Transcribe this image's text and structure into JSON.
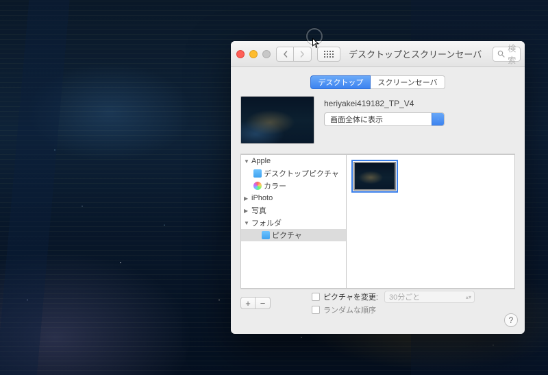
{
  "window": {
    "title": "デスクトップとスクリーンセーバ",
    "search_placeholder": "検索"
  },
  "tabs": {
    "desktop": "デスクトップ",
    "screensaver": "スクリーンセーバ"
  },
  "preview": {
    "filename": "heriyakei419182_TP_V4",
    "fit_mode": "画面全体に表示"
  },
  "sources": {
    "apple": "Apple",
    "desktop_pictures": "デスクトップピクチャ",
    "colors": "カラー",
    "iphoto": "iPhoto",
    "photos": "写真",
    "folders": "フォルダ",
    "pictures": "ピクチャ"
  },
  "footer": {
    "change_picture": "ピクチャを変更:",
    "interval": "30分ごと",
    "random_order": "ランダムな順序"
  }
}
